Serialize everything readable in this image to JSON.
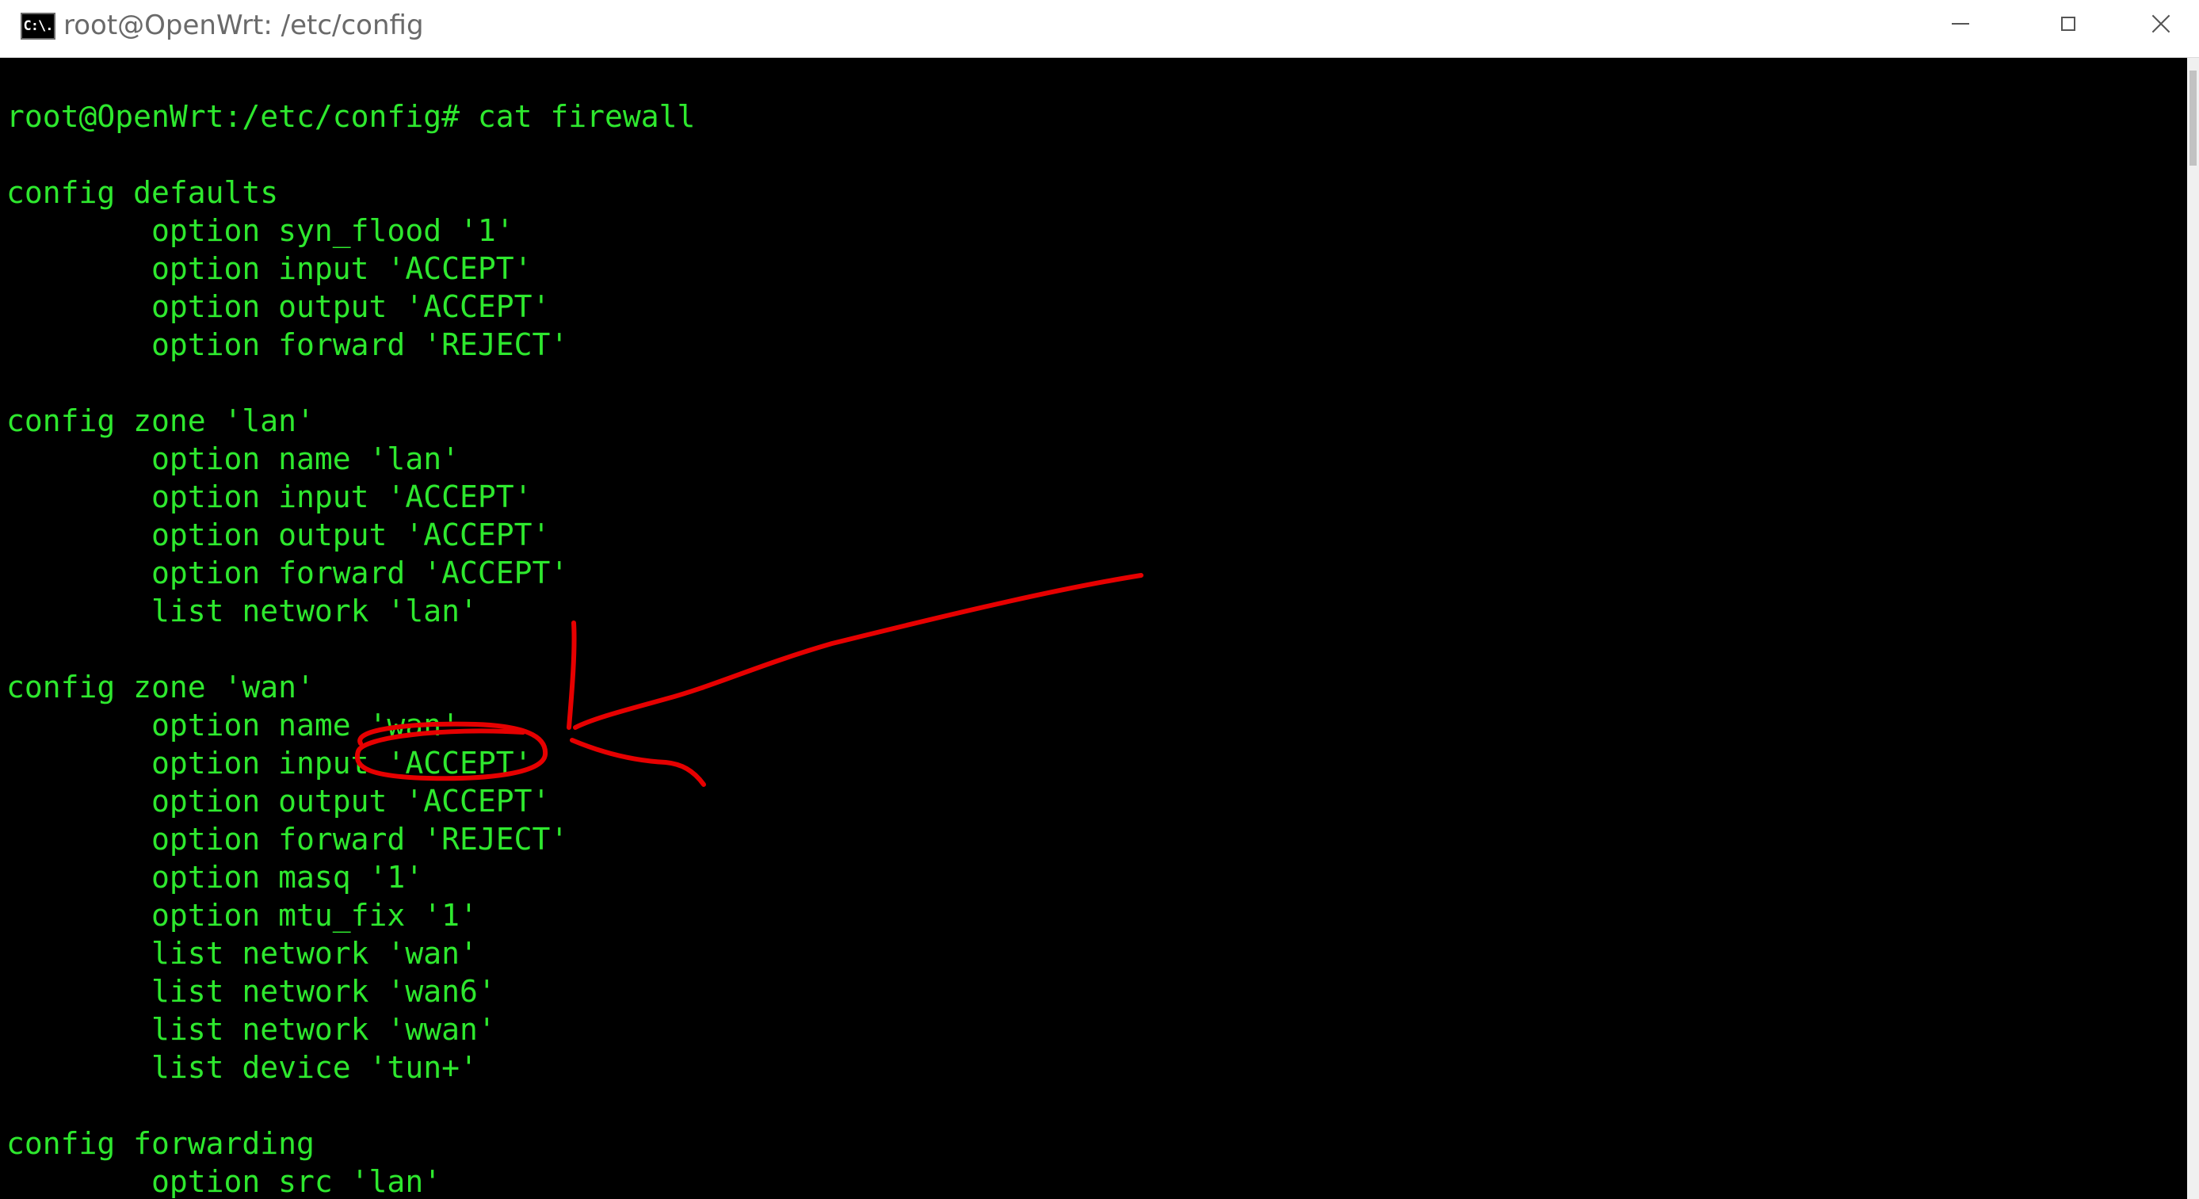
{
  "window": {
    "title": "root@OpenWrt: /etc/config",
    "icon_label": "C:\\."
  },
  "terminal": {
    "text_color": "#2ee82e",
    "background": "#000000",
    "lines": [
      "root@OpenWrt:/etc/config# cat firewall",
      "",
      "config defaults",
      "        option syn_flood '1'",
      "        option input 'ACCEPT'",
      "        option output 'ACCEPT'",
      "        option forward 'REJECT'",
      "",
      "config zone 'lan'",
      "        option name 'lan'",
      "        option input 'ACCEPT'",
      "        option output 'ACCEPT'",
      "        option forward 'ACCEPT'",
      "        list network 'lan'",
      "",
      "config zone 'wan'",
      "        option name 'wan'",
      "        option input 'ACCEPT'",
      "        option output 'ACCEPT'",
      "        option forward 'REJECT'",
      "        option masq '1'",
      "        option mtu_fix '1'",
      "        list network 'wan'",
      "        list network 'wan6'",
      "        list network 'wwan'",
      "        list device 'tun+'",
      "",
      "config forwarding",
      "        option src 'lan'"
    ]
  },
  "annotation": {
    "color": "#e60000"
  }
}
